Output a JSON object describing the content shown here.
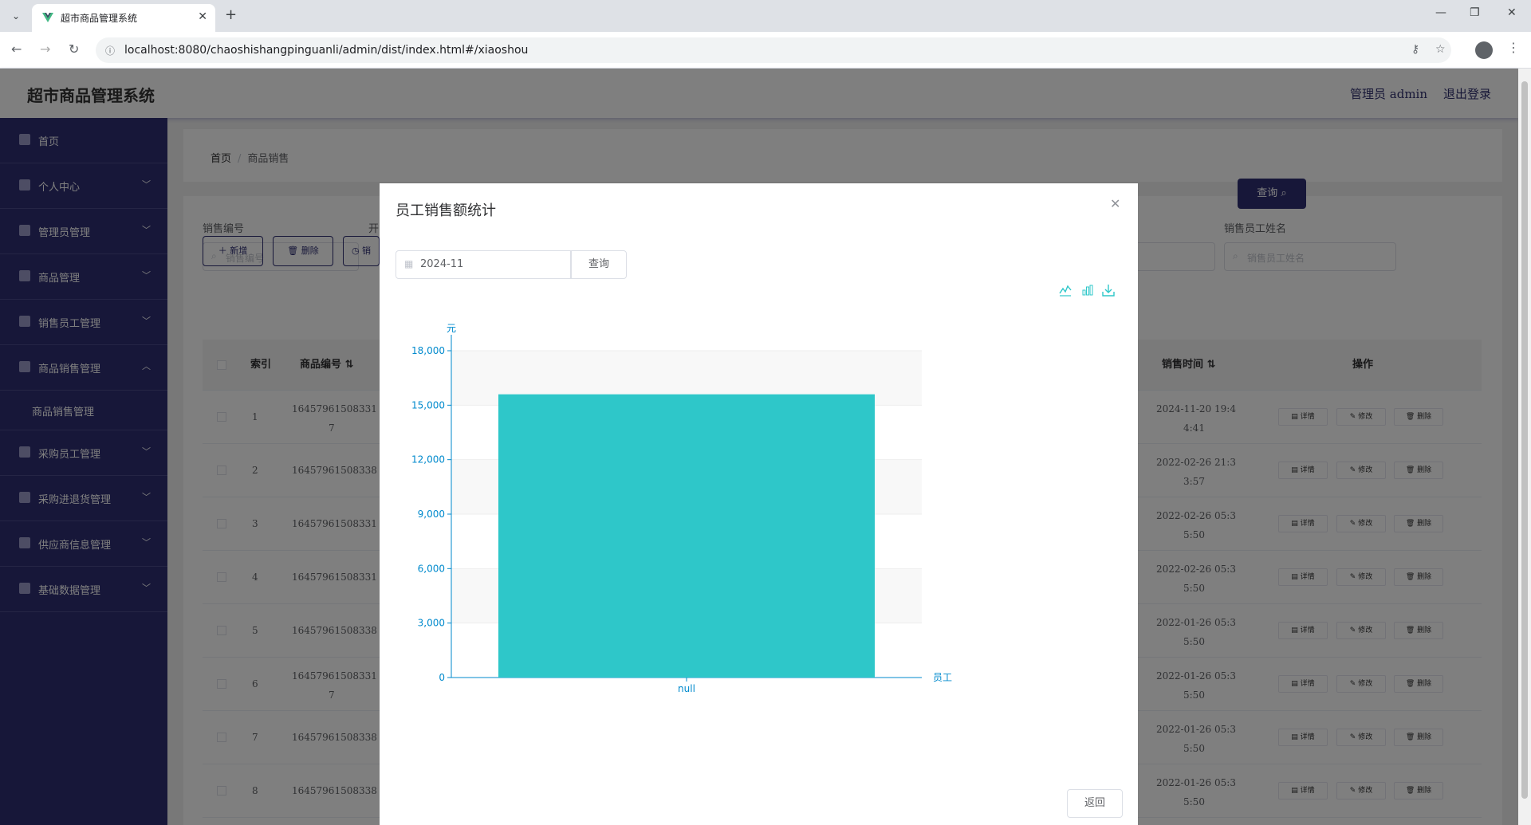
{
  "browser": {
    "tab_title": "超市商品管理系统",
    "url": "localhost:8080/chaoshishangpinguanli/admin/dist/index.html#/xiaoshou"
  },
  "header": {
    "title": "超市商品管理系统",
    "user": "管理员 admin",
    "logout": "退出登录"
  },
  "sidebar": {
    "items": [
      {
        "label": "首页",
        "icon": "home-icon"
      },
      {
        "label": "个人中心",
        "icon": "user-icon"
      },
      {
        "label": "管理员管理",
        "icon": "clipboard-icon"
      },
      {
        "label": "商品管理",
        "icon": "goods-icon"
      },
      {
        "label": "销售员工管理",
        "icon": "flag-icon"
      },
      {
        "label": "商品销售管理",
        "icon": "briefcase-icon"
      },
      {
        "label": "采购员工管理",
        "icon": "copy-icon"
      },
      {
        "label": "采购进退货管理",
        "icon": "mic-icon"
      },
      {
        "label": "供应商信息管理",
        "icon": "send-icon"
      },
      {
        "label": "基础数据管理",
        "icon": "grid-icon"
      }
    ],
    "sub_item": "商品销售管理"
  },
  "breadcrumb": {
    "home": "首页",
    "current": "商品销售"
  },
  "search": {
    "label1": "销售编号",
    "placeholder1": "销售编号",
    "label2_partial": "开",
    "label3": "销售员工姓名",
    "placeholder3": "销售员工姓名",
    "query": "查询"
  },
  "toolbar": {
    "add": "新增",
    "delete": "删除",
    "third": "销"
  },
  "table": {
    "headers": {
      "index": "索引",
      "product_no": "商品编号",
      "sale_time": "销售时间",
      "ops": "操作"
    },
    "rows": [
      {
        "index": "1",
        "no1": "16457961508331",
        "no2": "7",
        "time1": "2024-11-20 19:4",
        "time2": "4:41"
      },
      {
        "index": "2",
        "no1": "16457961508338",
        "no2": "",
        "time1": "2022-02-26 21:3",
        "time2": "3:57"
      },
      {
        "index": "3",
        "no1": "16457961508331",
        "no2": "",
        "time1": "2022-02-26 05:3",
        "time2": "5:50"
      },
      {
        "index": "4",
        "no1": "16457961508331",
        "no2": "",
        "time1": "2022-02-26 05:3",
        "time2": "5:50"
      },
      {
        "index": "5",
        "no1": "16457961508338",
        "no2": "",
        "time1": "2022-01-26 05:3",
        "time2": "5:50"
      },
      {
        "index": "6",
        "no1": "16457961508331",
        "no2": "7",
        "time1": "2022-01-26 05:3",
        "time2": "5:50"
      },
      {
        "index": "7",
        "no1": "16457961508338",
        "no2": "",
        "time1": "2022-01-26 05:3",
        "time2": "5:50"
      },
      {
        "index": "8",
        "no1": "16457961508338",
        "no2": "",
        "time1": "2022-01-26 05:3",
        "time2": "5:50"
      }
    ],
    "op_labels": {
      "detail": "详情",
      "edit": "修改",
      "delete": "删除"
    }
  },
  "dialog": {
    "title": "员工销售额统计",
    "date_value": "2024-11",
    "query": "查询",
    "back": "返回"
  },
  "chart_data": {
    "type": "bar",
    "categories": [
      "null"
    ],
    "values": [
      15600
    ],
    "ylabel": "元",
    "xlabel": "员工",
    "ylim": [
      0,
      18000
    ],
    "yticks": [
      "0",
      "3,000",
      "6,000",
      "9,000",
      "12,000",
      "15,000",
      "18,000"
    ],
    "bar_color": "#2ec7c9",
    "axis_color": "#008acd"
  }
}
